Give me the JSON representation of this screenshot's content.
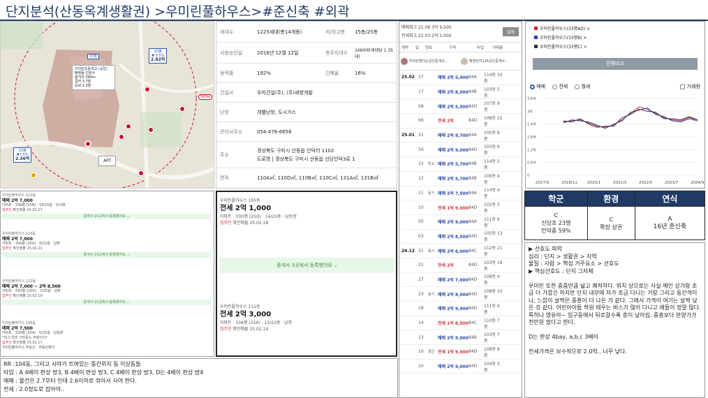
{
  "title": "단지분석(산동옥계생활권) >우미린풀하우스>#준신축 #외곽",
  "map": {
    "popup": [
      "우미린초등학교 (공립)",
      "배정동 인원수",
      "총거리 380m",
      "걸어 3.7분",
      "도보 1.3분"
    ],
    "marker_a": {
      "top": "33평",
      "l1": "▼-3.5%",
      "l2": "2.82억"
    },
    "marker_b": {
      "top": "33평",
      "l1": "▼7.5%",
      "l2": "2.36억"
    },
    "marker_c": {
      "top": "33평"
    },
    "apt": "APT",
    "dist": "500m"
  },
  "info": {
    "rows": [
      {
        "k": "세대수",
        "v": "1225세대(총14개동)",
        "k2": "저/최고층",
        "v2": "15층/25층"
      },
      {
        "k": "사용승인일",
        "v": "2016년 12월 12일",
        "k2": "총주차대수",
        "v2": "1660대(세대당 1.35대)"
      },
      {
        "k": "용적률",
        "v": "192%",
        "k2": "건폐율",
        "v2": "16%"
      },
      {
        "k": "건설사",
        "v": "우미건설(주), (주)세향개발"
      },
      {
        "k": "난방",
        "v": "개별난방, 도시가스"
      },
      {
        "k": "관리사무소",
        "v": "054-476-6656"
      },
      {
        "k": "주소",
        "v": "경상북도 구미시 산동읍 인덕리 1102",
        "v_b": "도로명 | 경상북도 구미시 산동읍 신당인덕3로 1"
      },
      {
        "k": "면적",
        "v": "110A㎡, 110D㎡, 110B㎡, 110C㎡, 131A㎡, 131B㎡"
      }
    ]
  },
  "listings": [
    {
      "name": "우미린풀하우스 112동",
      "price": "매매 2억 7,000",
      "detail": "아파트 · 33B평 (25B) · 14/25층 · 남서향",
      "tag": "집주인",
      "date": "확인매물 25.02.27",
      "bar": "중개사 15곳에서 등록했어요 ⌄"
    },
    {
      "name": "우미린풀하우스 114동",
      "price": "매매 2억 7,000",
      "detail": "아파트 · 33A평 (25A) · 9/22층 · 남향",
      "tag": "집주인",
      "date": "확인매물 25.02.21",
      "bar": "중개사 15곳에서 등록했어요 ⌄"
    },
    {
      "name": "우미린풀하우스 112동",
      "price": "매매 2억 7,000 ~ 2억 8,500",
      "detail": "아파트 · 33D평 (25D) · 7/25층 · 남향",
      "tag": "집주인",
      "date": "확인매물 25.02.19",
      "bar": "중개사 15곳에서 등록했어요 ⌄"
    },
    {
      "name": "우미린풀하우스 106동",
      "price": "매매 2억 7,500",
      "detail": "아파트 · 33A평 (25A) · 5/25층 · 남동향",
      "note": "*최고 미러 가라운드 부분이다*",
      "tag": "집주인",
      "date": "확인매물 25.02.17",
      "sub": "우미린풀하우스 부동산 · 부동산뱅크"
    }
  ],
  "big_listings": [
    {
      "name": "우미린풀하우스 105동",
      "price": "전세 2억 1,000",
      "detail": "아파트 · 33D평 (25D) · 14/25층 · 남동향",
      "tag": "집주인",
      "date": "확인매물 25.02.18",
      "bar": "중개사 3곳에서 등록했어요 ⌄"
    },
    {
      "name": "우미린풀하우스 111동",
      "price": "전세 2억 3,000",
      "detail": "아파트 · 33A평 (25A) · 13/22층 · 남향",
      "tag": "집주인",
      "date": "확인매물 25.02.14"
    }
  ],
  "trade": {
    "hdr1": "매매최고 21.08 3억 9,500",
    "hdr2": "전세최고 22.03 2억 1,000",
    "set_btn": "설정",
    "cols": [
      "계약",
      "일",
      "정보",
      "가격",
      "타입",
      "거래층"
    ],
    "agents": [
      "우미린헨더슨공인중개사…",
      "확장단지114공인중개사…"
    ],
    "rows": [
      [
        "25.02",
        "27",
        "",
        "매매 2억 5,400",
        "84A",
        "114동 10층"
      ],
      [
        "",
        "17",
        "",
        "매매 2억 8,000",
        "84B",
        "103동 5층"
      ],
      [
        "",
        "08",
        "",
        "매매 2억 5,500",
        "84D",
        "107동 9층"
      ],
      [
        "",
        "06",
        "",
        "전세 2억",
        "84D",
        "108동 22층"
      ],
      [
        "25.01",
        "31",
        "",
        "매매 2억 8,700",
        "84A",
        "105동 8층"
      ],
      [
        "",
        "16",
        "",
        "매매 2억 9,000",
        "84D",
        "103동 6층"
      ],
      [
        "",
        "12",
        "취소",
        "매매 2억 5,700",
        "84B",
        "114동 2층"
      ],
      [
        "",
        "12",
        "",
        "매매 2억 5,700",
        "84B",
        "106동 4층"
      ],
      [
        "",
        "11",
        "동기",
        "매매 2억 7,500",
        "84A",
        "114동 4층"
      ],
      [
        "",
        "10",
        "",
        "전세 1억 9,000",
        "84D",
        "102동 3층"
      ],
      [
        "",
        "05",
        "",
        "매매 2억 9,000",
        "84A",
        "111동 6층"
      ],
      [
        "",
        "03",
        "",
        "매매 2억 8,500",
        "84D",
        "105동 13층"
      ],
      [
        "24.12",
        "31",
        "동기",
        "매매 2억 6,000",
        "84C",
        "112동 21층"
      ],
      [
        "",
        "31",
        "",
        "전세 2억",
        "84D",
        "103동 16층"
      ],
      [
        "",
        "27",
        "",
        "매매 2억 7,000",
        "84D",
        "108동 4층"
      ],
      [
        "",
        "23",
        "동기",
        "매매 2억 8,900",
        "84D",
        "108동 10층"
      ],
      [
        "",
        "18",
        "",
        "매매 2억 9,400",
        "84D",
        "111동 9층"
      ],
      [
        "",
        "14",
        "",
        "전세 1억 8,500",
        "84C",
        "110동 7층"
      ],
      [
        "",
        "13",
        "",
        "매매 2억 9,000",
        "84B",
        "103동 7층"
      ],
      [
        "",
        "10",
        "경신",
        "전세 1억 9,000",
        "84D",
        "108동 8층"
      ],
      [
        "",
        "10",
        "",
        "매매 2억 9,000",
        "84D",
        "104동 3층"
      ]
    ]
  },
  "chart_data": {
    "type": "line",
    "legend": [
      "우미린풀하우스(33평AD) ×",
      "우미린풀하우스(33평B) ×",
      "우미린풀하우스(33평C) ×"
    ],
    "legend_colors": [
      "#d8202e",
      "#2a3fb0",
      "#333333"
    ],
    "btn": "전체비교",
    "radios": [
      "매매",
      "전세",
      "월세"
    ],
    "checkbox": "거래량",
    "x": [
      "2017/9",
      "2018/11",
      "2020/1",
      "2021/3",
      "2022/5",
      "2023/7",
      "2024/9"
    ],
    "ylim": [
      0,
      3.6
    ],
    "yticks": [
      "3.6억",
      "3억",
      "2.4억",
      "1.8억",
      "1.2억",
      "0.6억",
      "0"
    ],
    "series": [
      {
        "name": "우미린풀하우스(33평AD)",
        "values": [
          2.5,
          2.55,
          2.6,
          2.45,
          2.3,
          2.25,
          2.35,
          2.6,
          2.9,
          3.2,
          3.1,
          2.9,
          2.7,
          2.6,
          2.55,
          2.7,
          2.6
        ]
      },
      {
        "name": "우미린풀하우스(33평B)",
        "values": [
          2.45,
          2.6,
          2.55,
          2.5,
          2.35,
          2.2,
          2.4,
          2.55,
          2.95,
          3.05,
          3.15,
          2.85,
          2.75,
          2.55,
          2.5,
          2.65,
          2.55
        ]
      },
      {
        "name": "우미린풀하우스(33평C)",
        "values": [
          2.55,
          2.5,
          2.65,
          2.4,
          2.25,
          2.3,
          2.3,
          2.7,
          2.85,
          3.1,
          3.0,
          2.95,
          2.65,
          2.65,
          2.6,
          2.75,
          2.6
        ]
      }
    ],
    "series_colors": [
      "#d8202e",
      "#2a3fb0",
      "#333333"
    ]
  },
  "grade": {
    "headers": [
      "학군",
      "환경",
      "연식"
    ],
    "school": [
      "C",
      "신당초 23명",
      "인덕중 59%"
    ],
    "env": [
      "C",
      "확장 상권"
    ],
    "age": [
      "A",
      "16년 준신축"
    ]
  },
  "notes": [
    "▶ 선호도 파악",
    "심리 : 단지 > 생활권 > 지역",
    "물질 : 사람 > 핵심 거주요소 > 선호도",
    "",
    "▶ 핵심선호도 : 단지 그자체",
    "",
    "우미린 또한 중품만큼 넓고 쾌적하다. 위치 상으로는 사실 메인 상가랑 조금 더 가깝긴 하지만 단지 내부에 차가 조금 다니는 거랑 그리고 동간격이나, 느낌이 살짝은 중흥이 더 나은 거 같다. 그래서 가격이 여기는 살짝 낮은 것 같다. 어린아이들 학원 태우는 버스가 많이 다니고 애들이 정말 많다. 특히나 영유아~ 입구동에서 뒤로갈수록 층이 낮아짐. 중흥보다 분양가가 천만원 쌌다고 한다.",
    "",
    "D는 판상 4bay, a,b,c 3베이",
    "",
    "전세가격은 보수적으로 2.0억.. 너무 낮다."
  ],
  "bottom": [
    "RR :104동, 그리고 시야가 트여있는 중간위치 동 이상동들",
    "타입 : A 4베이 판상 방3, B 4베이 판상 방3, C 4베이 판상 방3, D는 4베이 판상 방4",
    "매매 : 물건은 2.7부터 인데 2.6이하로 깎아서 사야 한다.",
    "전세 : 2.0정도로 잡아야.."
  ]
}
